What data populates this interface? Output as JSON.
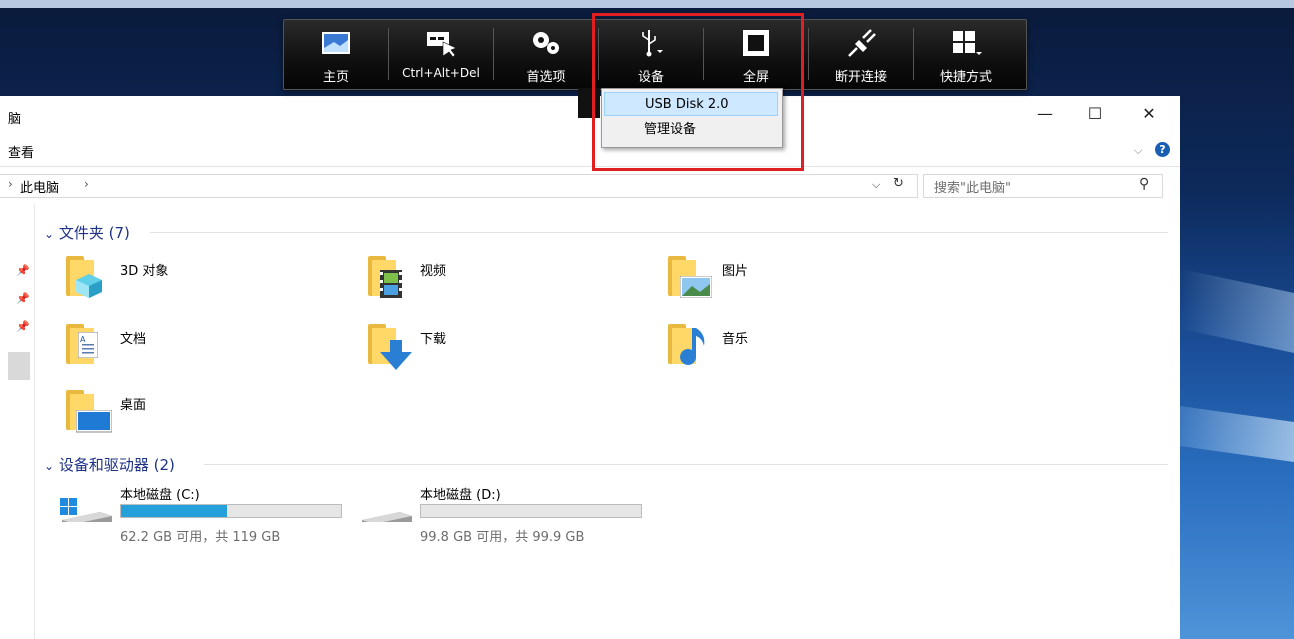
{
  "window": {
    "title_partial": "脑",
    "ribbon_label": "查看",
    "minimize": "—",
    "maximize": "☐",
    "close": "✕",
    "help": "?"
  },
  "address": {
    "separator": "›",
    "path": "此电脑",
    "arrow": "›",
    "search_placeholder": "搜索\"此电脑\""
  },
  "groups": {
    "folders_header": "文件夹 (7)",
    "drives_header": "设备和驱动器 (2)"
  },
  "folders": [
    {
      "label": "3D 对象",
      "icon": "3d-objects-icon"
    },
    {
      "label": "视频",
      "icon": "videos-icon"
    },
    {
      "label": "图片",
      "icon": "pictures-icon"
    },
    {
      "label": "文档",
      "icon": "documents-icon"
    },
    {
      "label": "下载",
      "icon": "downloads-icon"
    },
    {
      "label": "音乐",
      "icon": "music-icon"
    },
    {
      "label": "桌面",
      "icon": "desktop-icon"
    }
  ],
  "drives": [
    {
      "label": "本地磁盘 (C:)",
      "free": "62.2 GB 可用，共 119 GB",
      "used_fraction": 0.48
    },
    {
      "label": "本地磁盘 (D:)",
      "free": "99.8 GB 可用，共 99.9 GB",
      "used_fraction": 0.001
    }
  ],
  "toolbar": {
    "items": [
      {
        "label": "主页",
        "icon": "home-icon"
      },
      {
        "label": "Ctrl+Alt+Del",
        "icon": "ctrl-alt-del-icon"
      },
      {
        "label": "首选项",
        "icon": "gears-icon"
      },
      {
        "label": "设备",
        "icon": "usb-icon"
      },
      {
        "label": "全屏",
        "icon": "fullscreen-icon"
      },
      {
        "label": "断开连接",
        "icon": "disconnect-icon"
      },
      {
        "label": "快捷方式",
        "icon": "shortcuts-icon"
      }
    ]
  },
  "dropdown": {
    "items": [
      "USB Disk 2.0",
      "管理设备"
    ]
  },
  "colors": {
    "accent": "#26a0da",
    "highlight": "#e02020",
    "group_header": "#1e3287"
  }
}
